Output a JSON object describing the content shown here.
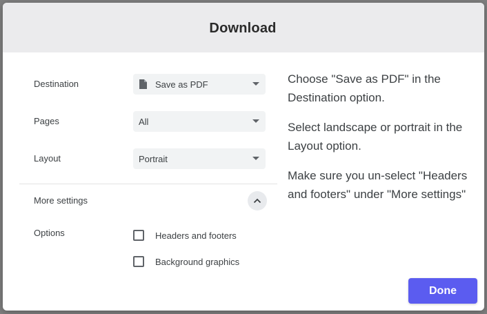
{
  "dialog": {
    "title": "Download"
  },
  "settings": {
    "destination": {
      "label": "Destination",
      "value": "Save as PDF",
      "icon": "document-icon"
    },
    "pages": {
      "label": "Pages",
      "value": "All"
    },
    "layout": {
      "label": "Layout",
      "value": "Portrait"
    },
    "more_settings": {
      "label": "More settings",
      "icon": "chevron-up-icon"
    },
    "options": {
      "label": "Options",
      "items": [
        {
          "label": "Headers and footers",
          "checked": false
        },
        {
          "label": "Background graphics",
          "checked": false
        }
      ]
    }
  },
  "instructions": [
    "Choose \"Save as PDF\" in the Destination option.",
    "Select landscape or portrait in the Layout option.",
    "Make sure you un-select \"Headers and footers\" under \"More settings\""
  ],
  "actions": {
    "done_label": "Done"
  },
  "colors": {
    "accent": "#5b5cf0",
    "header_bg": "#ebebed",
    "select_bg": "#f1f3f4",
    "backdrop": "#7f7f7f"
  }
}
